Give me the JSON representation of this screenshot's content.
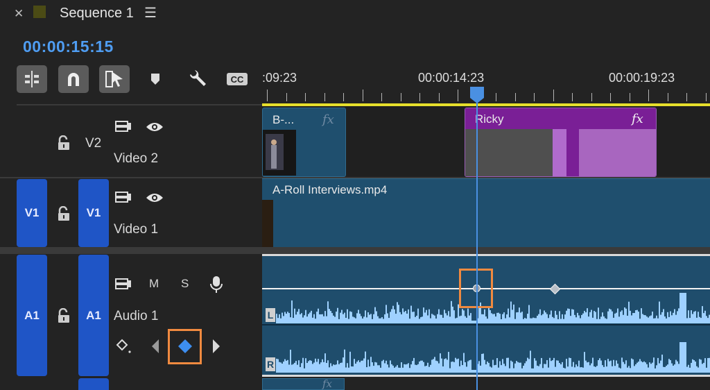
{
  "sequence": {
    "close_icon": "close-icon",
    "title": "Sequence 1",
    "menu_icon": "hamburger-menu-icon",
    "swatch_color": "#4b4b15"
  },
  "timecode": "00:00:15:15",
  "toolbar": {
    "tools": [
      "insert-edit-icon",
      "snap-magnet-icon",
      "linked-selection-icon",
      "add-marker-icon",
      "timeline-settings-wrench-icon",
      "captions-cc-icon"
    ],
    "cc_label": "CC"
  },
  "ruler": {
    "labels": [
      ":09:23",
      "00:00:14:23",
      "00:00:19:23"
    ],
    "work_area_color": "#e6df2c",
    "playhead_color": "#4a90e2"
  },
  "tracks": {
    "v2": {
      "target": "V2",
      "name": "Video 2"
    },
    "v1": {
      "source": "V1",
      "target": "V1",
      "name": "Video 1"
    },
    "a1": {
      "source": "A1",
      "target": "A1",
      "name": "Audio 1",
      "mute": "M",
      "solo": "S"
    }
  },
  "clips": {
    "b_roll": {
      "label": "B-...",
      "fx": "fx"
    },
    "ricky": {
      "label": "Ricky",
      "fx": "fx",
      "color": "#7a1f96"
    },
    "a_roll": {
      "label": "A-Roll Interviews.mp4"
    },
    "audio_channels": [
      "L",
      "R"
    ],
    "next_clip_fx": "fx"
  },
  "highlight_color": "#f08a40"
}
